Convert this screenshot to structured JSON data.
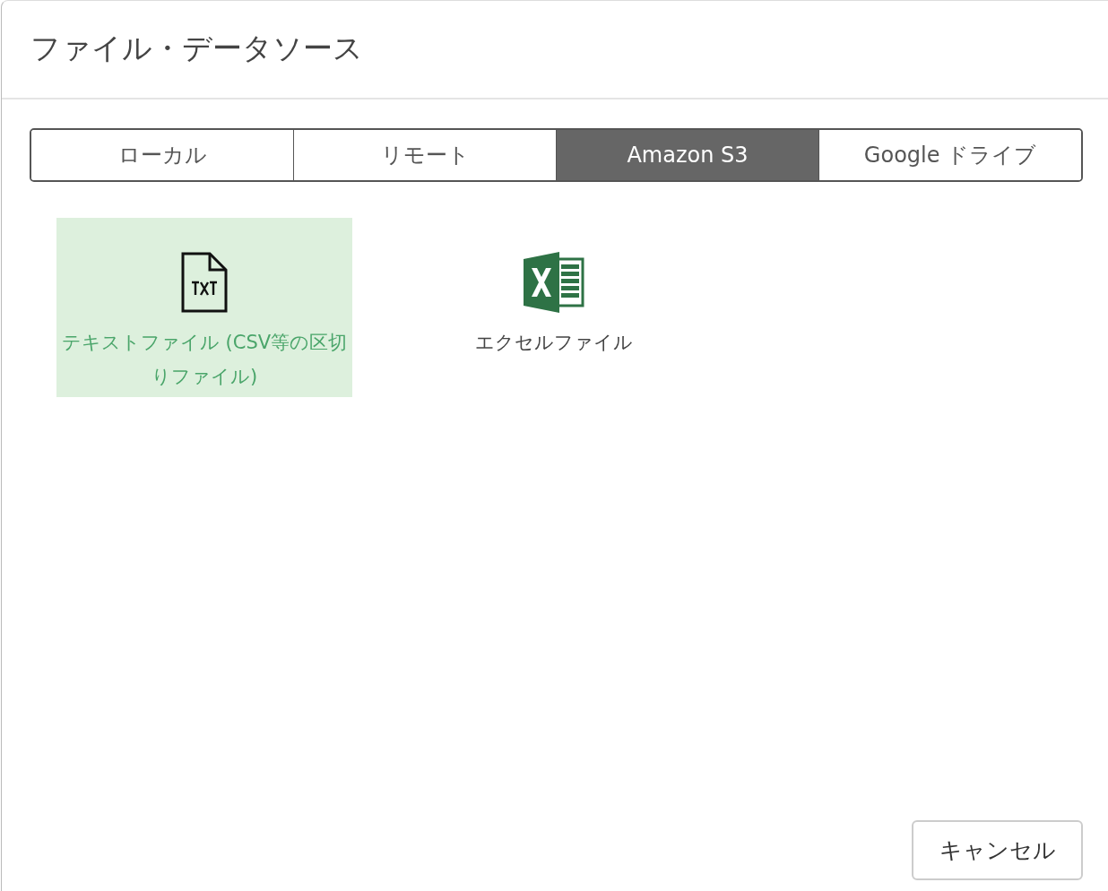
{
  "dialog": {
    "title": "ファイル・データソース"
  },
  "tabs": [
    {
      "label": "ローカル",
      "selected": false
    },
    {
      "label": "リモート",
      "selected": false
    },
    {
      "label": "Amazon S3",
      "selected": true
    },
    {
      "label": "Google ドライブ",
      "selected": false
    }
  ],
  "file_types": [
    {
      "kind": "txt",
      "label": "テキストファイル (CSV等の区切りファイル)",
      "selected": true
    },
    {
      "kind": "excel",
      "label": "エクセルファイル",
      "selected": false
    }
  ],
  "buttons": [
    {
      "label": "キャンセル"
    }
  ]
}
